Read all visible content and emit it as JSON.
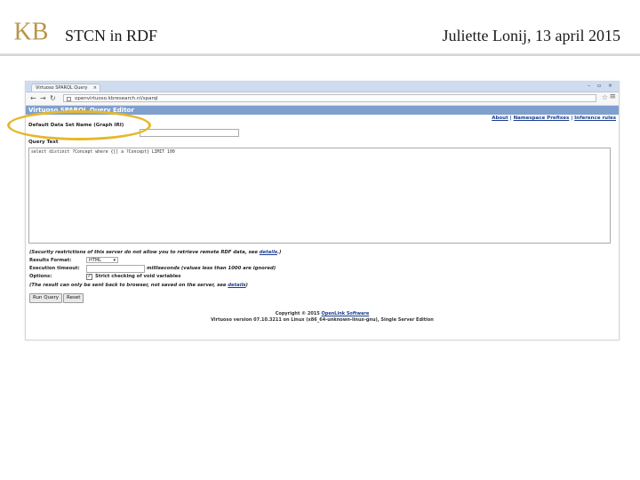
{
  "slide": {
    "logo_text": "KB",
    "title": "STCN in RDF",
    "author_date": "Juliette Lonij, 13 april 2015"
  },
  "browser": {
    "tab_title": "Virtuoso SPARQL Query",
    "tab_close": "×",
    "window_controls": "– ▫ ×",
    "url": "openvirtuoso.kbresearch.nl/sparql"
  },
  "page": {
    "banner_title": "Virtuoso SPARQL Query Editor",
    "top_links": [
      "About",
      "Namespace Prefixes",
      "Inference rules"
    ],
    "default_dataset_label": "Default Data Set Name (Graph IRI)",
    "query_text_label": "Query Text",
    "query_text": "select distinct ?Concept where {[] a ?Concept} LIMIT 100",
    "security_note": "(Security restrictions of this server do not allow you to retrieve remote RDF data, see ",
    "security_note_link": "details",
    "security_note_end": ".)",
    "results_format_label": "Results Format:",
    "results_format_value": "HTML",
    "execution_timeout_label": "Execution timeout:",
    "timeout_hint": "milliseconds (values less than 1000 are ignored)",
    "options_label": "Options:",
    "strict_checking_label": "Strict checking of void variables",
    "result_note": "(The result can only be sent back to browser, not saved on the server, see ",
    "result_note_link": "details",
    "result_note_end": ")",
    "run_query_button": "Run Query",
    "reset_button": "Reset",
    "copyright_prefix": "Copyright © 2015 ",
    "copyright_link": "OpenLink Software",
    "version_line": "Virtuoso version 07.10.3211 on Linux (x86_64-unknown-linux-gnu), Single Server Edition"
  },
  "colors": {
    "annotation": "#e5b82c",
    "banner": "#7f9fcf",
    "link": "#1b3d8f"
  }
}
